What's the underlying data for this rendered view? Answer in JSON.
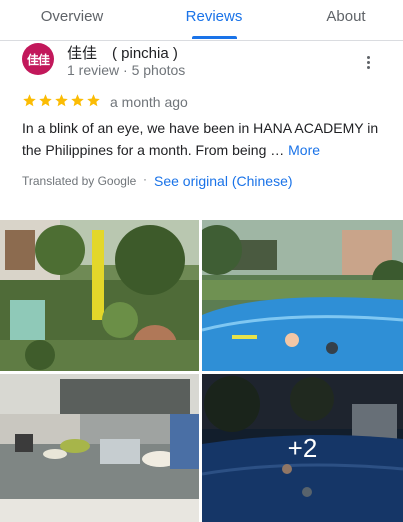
{
  "tabs": [
    {
      "label": "Overview"
    },
    {
      "label": "Reviews"
    },
    {
      "label": "About"
    }
  ],
  "review": {
    "avatar_text": "佳佳",
    "author": "佳佳　( pinchia )",
    "meta": "1 review · 5 photos",
    "rating": 5,
    "when": "a month ago",
    "text": "In a blink of an eye, we have been in HANA ACADEMY in the Philippines for a month. From being …",
    "more_label": "More",
    "translated_label": "Translated by Google",
    "separator": "·",
    "original_link": "See original (Chinese)"
  },
  "photos": {
    "more_count": "+2"
  },
  "colors": {
    "accent": "#1a73e8",
    "star": "#fbbc04",
    "avatar": "#c2185b"
  }
}
